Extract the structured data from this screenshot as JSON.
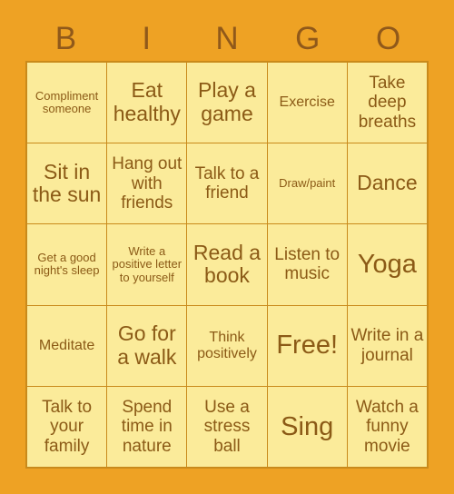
{
  "card": {
    "title_letters": [
      "B",
      "I",
      "N",
      "G",
      "O"
    ],
    "colors": {
      "background": "#eea224",
      "cell_fill": "#fbeb9a",
      "grid_line": "#c98a1b",
      "text": "#8b5a16",
      "header_text": "#90591a"
    },
    "rows": [
      [
        {
          "text": "Compliment someone",
          "size": "fs-xs"
        },
        {
          "text": "Eat healthy",
          "size": "fs-lg"
        },
        {
          "text": "Play a game",
          "size": "fs-lg"
        },
        {
          "text": "Exercise",
          "size": "fs-sm"
        },
        {
          "text": "Take deep breaths",
          "size": "fs-md"
        }
      ],
      [
        {
          "text": "Sit in the sun",
          "size": "fs-lg"
        },
        {
          "text": "Hang out with friends",
          "size": "fs-md"
        },
        {
          "text": "Talk to a friend",
          "size": "fs-md"
        },
        {
          "text": "Draw/paint",
          "size": "fs-xs"
        },
        {
          "text": "Dance",
          "size": "fs-lg"
        }
      ],
      [
        {
          "text": "Get a good night's sleep",
          "size": "fs-xs"
        },
        {
          "text": "Write a positive letter to yourself",
          "size": "fs-xs"
        },
        {
          "text": "Read a book",
          "size": "fs-lg"
        },
        {
          "text": "Listen to music",
          "size": "fs-md"
        },
        {
          "text": "Yoga",
          "size": "fs-xl"
        }
      ],
      [
        {
          "text": "Meditate",
          "size": "fs-sm"
        },
        {
          "text": "Go for a walk",
          "size": "fs-lg"
        },
        {
          "text": "Think positively",
          "size": "fs-sm"
        },
        {
          "text": "Free!",
          "size": "fs-xl"
        },
        {
          "text": "Write in a journal",
          "size": "fs-md"
        }
      ],
      [
        {
          "text": "Talk to your family",
          "size": "fs-md"
        },
        {
          "text": "Spend time in nature",
          "size": "fs-md"
        },
        {
          "text": "Use a stress ball",
          "size": "fs-md"
        },
        {
          "text": "Sing",
          "size": "fs-xl"
        },
        {
          "text": "Watch a funny movie",
          "size": "fs-md"
        }
      ]
    ]
  }
}
